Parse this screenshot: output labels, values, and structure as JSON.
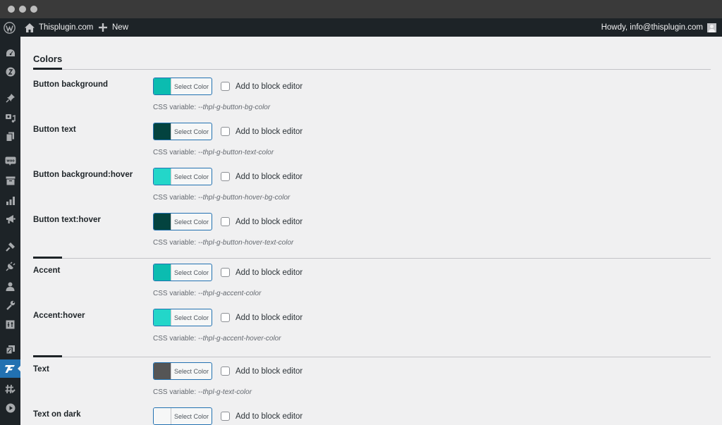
{
  "window": {
    "traffic_lights": [
      "close",
      "minimize",
      "maximize"
    ]
  },
  "adminbar": {
    "wp_logo_icon": "wordpress-logo-icon",
    "site_icon": "home-icon",
    "site_name": "Thisplugin.com",
    "new_icon": "plus-icon",
    "new_label": "New",
    "greeting": "Howdy, info@thisplugin.com",
    "avatar_icon": "user-avatar-icon"
  },
  "sidebar": {
    "items": [
      {
        "icon": "dashboard-icon"
      },
      {
        "icon": "plugin-brand-icon"
      },
      {
        "icon": "pin-icon"
      },
      {
        "icon": "media-icon"
      },
      {
        "icon": "pages-icon"
      },
      {
        "icon": "woocommerce-icon"
      },
      {
        "icon": "products-icon"
      },
      {
        "icon": "analytics-icon"
      },
      {
        "icon": "marketing-icon"
      },
      {
        "icon": "appearance-icon"
      },
      {
        "icon": "plugins-icon"
      },
      {
        "icon": "users-icon"
      },
      {
        "icon": "tools-icon"
      },
      {
        "icon": "settings-icon"
      },
      {
        "icon": "plugin-block-icon"
      },
      {
        "icon": "thisplugin-icon",
        "active": true
      },
      {
        "icon": "slug-icon"
      },
      {
        "icon": "play-icon"
      }
    ]
  },
  "main": {
    "section_title": "Colors",
    "select_color_label": "Select Color",
    "checkbox_label": "Add to block editor",
    "css_var_prefix": "CSS variable:",
    "groups": [
      {
        "rows": [
          {
            "label": "Button background",
            "color": "#0bbcb0",
            "css_var": "--thpl-g-button-bg-color",
            "checked": false
          },
          {
            "label": "Button text",
            "color": "#03433f",
            "css_var": "--thpl-g-button-text-color",
            "checked": false
          },
          {
            "label": "Button background:hover",
            "color": "#23d6c9",
            "css_var": "--thpl-g-button-hover-bg-color",
            "checked": false
          },
          {
            "label": "Button text:hover",
            "color": "#03433f",
            "css_var": "--thpl-g-button-hover-text-color",
            "checked": false
          }
        ]
      },
      {
        "rows": [
          {
            "label": "Accent",
            "color": "#0bbcb0",
            "css_var": "--thpl-g-accent-color",
            "checked": false
          },
          {
            "label": "Accent:hover",
            "color": "#23d6c9",
            "css_var": "--thpl-g-accent-hover-color",
            "checked": false
          }
        ]
      },
      {
        "rows": [
          {
            "label": "Text",
            "color": "#555555",
            "css_var": "--thpl-g-text-color",
            "checked": false
          },
          {
            "label": "Text on dark",
            "color": "#f6f7f7",
            "css_var": "",
            "checked": false
          }
        ]
      }
    ]
  }
}
